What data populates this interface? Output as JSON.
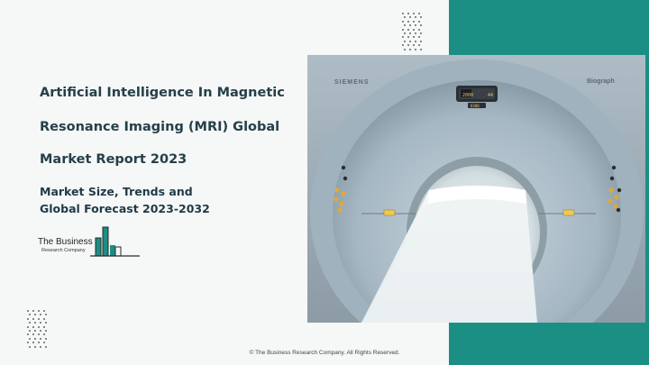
{
  "report": {
    "title_line1": "Artificial Intelligence In Magnetic",
    "title_line2": "Resonance Imaging (MRI) Global",
    "title_line3": "Market Report 2023",
    "subtitle_line1": "Market Size, Trends and",
    "subtitle_line2": "Global Forecast 2023-2032"
  },
  "logo": {
    "name": "The Business",
    "sub": "Research Company"
  },
  "photo": {
    "brand_left": "SIEMENS",
    "brand_right": "Biograph",
    "display_left": "2000",
    "display_right": "44",
    "display_bottom": "0300",
    "icon": "mri-scanner-photo"
  },
  "footer": {
    "copyright": "© The Business Research Company. All Rights Reserved."
  },
  "colors": {
    "teal": "#1b8f84",
    "title": "#25404a",
    "logo_green": "#1b8f84"
  }
}
